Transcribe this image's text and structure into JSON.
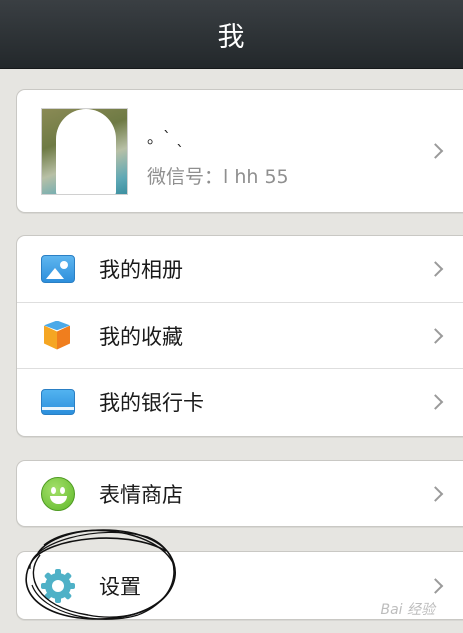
{
  "header": {
    "title": "我"
  },
  "profile": {
    "nickname": "。ˋ ˎ",
    "wechat_id_label": "微信号：",
    "wechat_id_value": "l  hh        55"
  },
  "menu": {
    "album": "我的相册",
    "favorites": "我的收藏",
    "bank_card": "我的银行卡",
    "sticker_store": "表情商店",
    "settings": "设置"
  },
  "watermark": "Bai 经验",
  "icons": {
    "album": "photo-album-icon",
    "favorites": "favorites-box-icon",
    "bank_card": "bank-card-icon",
    "sticker_store": "smiley-icon",
    "settings": "gear-icon",
    "chevron": "chevron-right-icon"
  },
  "colors": {
    "topbar": "#2b3033",
    "background": "#e6e5e1",
    "card": "#ffffff",
    "accent_blue": "#2d8fdc",
    "accent_green": "#5fb82a",
    "gear_teal": "#4fb1c7"
  }
}
